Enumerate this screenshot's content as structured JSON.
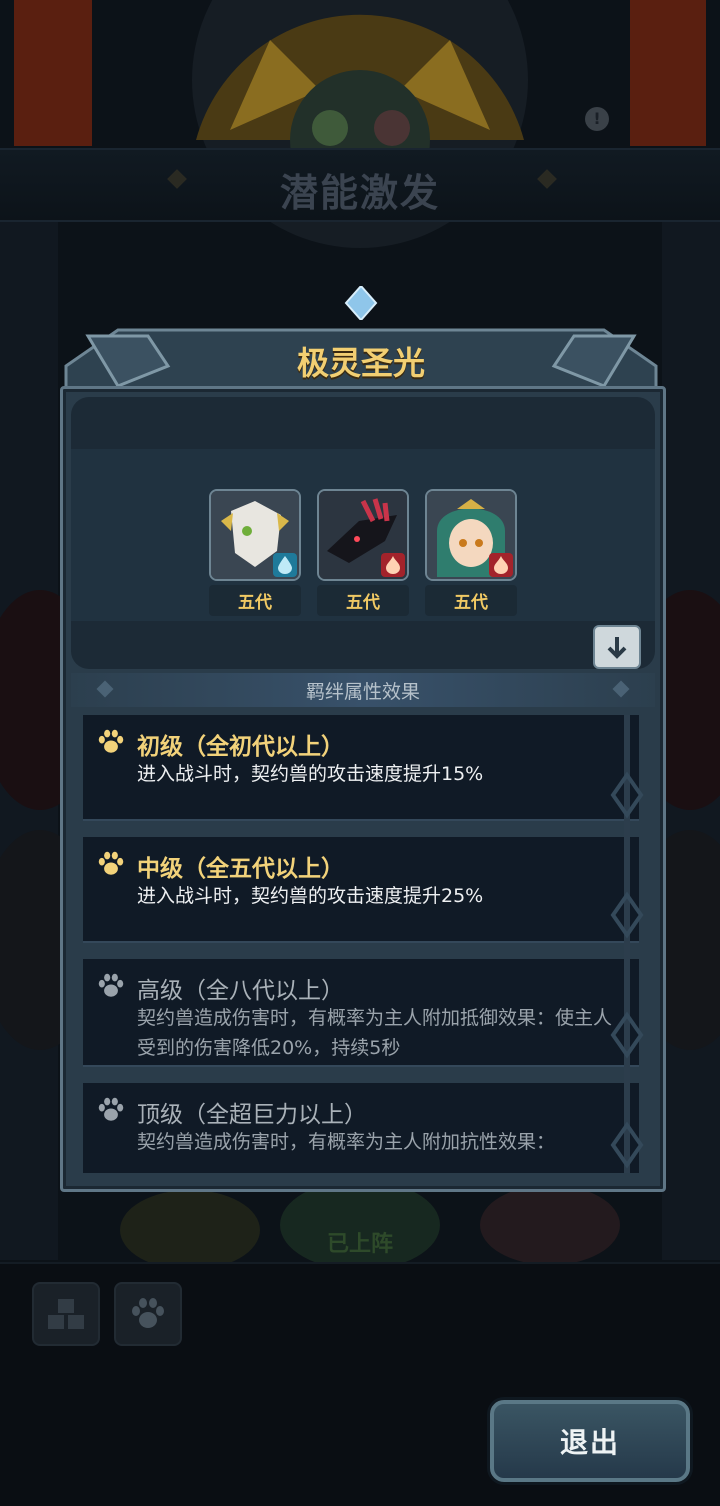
{
  "background": {
    "title": "潜能激发",
    "info_glyph": "!",
    "on_field_label": "已上阵"
  },
  "dialog": {
    "title": "极灵圣光",
    "heroes": [
      {
        "generation": "五代",
        "element": "water-icon"
      },
      {
        "generation": "五代",
        "element": "fire-icon"
      },
      {
        "generation": "五代",
        "element": "fire-icon"
      }
    ],
    "section_title": "羁绊属性效果",
    "effects": [
      {
        "title": "初级（全初代以上）",
        "desc": "进入战斗时，契约兽的攻击速度提升15%",
        "active": true
      },
      {
        "title": "中级（全五代以上）",
        "desc": "进入战斗时，契约兽的攻击速度提升25%",
        "active": true
      },
      {
        "title": "高级（全八代以上）",
        "desc": "契约兽造成伤害时，有概率为主人附加抵御效果：使主人受到的伤害降低20%，持续5秒",
        "active": false
      },
      {
        "title": "顶级（全超巨力以上）",
        "desc": "契约兽造成伤害时，有概率为主人附加抗性效果：",
        "active": false
      }
    ]
  },
  "bottom": {
    "exit_label": "退出"
  },
  "colors": {
    "gold": "#f2d27a",
    "panel": "#101a26",
    "frame": "#5f7686"
  }
}
